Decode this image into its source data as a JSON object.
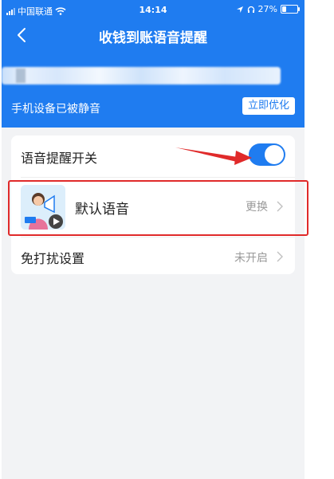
{
  "status_bar": {
    "carrier": "中国联通",
    "time": "14:14",
    "battery": "27%",
    "battery_level": 0.27
  },
  "navbar": {
    "title": "收钱到账语音提醒",
    "back_icon": "chevron-left-icon"
  },
  "banner": {
    "silent_notice": "手机设备已被静音",
    "optimize_label": "立即优化"
  },
  "settings": {
    "voice_switch": {
      "label": "语音提醒开关",
      "enabled": true
    },
    "voice_type": {
      "label": "默认语音",
      "action": "更换",
      "icon": "voice-avatar-icon"
    },
    "do_not_disturb": {
      "label": "免打扰设置",
      "value": "未开启"
    }
  },
  "colors": {
    "primary": "#1f7cf0",
    "annotation": "#e02a2a",
    "background": "#f2f3f5"
  }
}
